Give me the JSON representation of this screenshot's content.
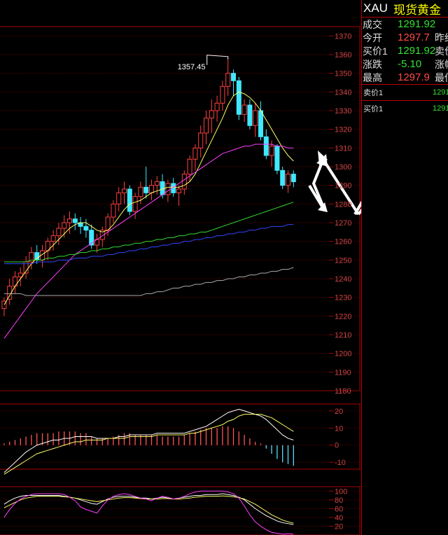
{
  "sidebar": {
    "symbol": "XAU",
    "name": "现货黄金",
    "quotes": [
      {
        "label": "成交",
        "value": "1291.92",
        "color": "dn",
        "tail": ""
      },
      {
        "label": "今开",
        "value": "1297.7",
        "color": "up",
        "tail": "昨结"
      },
      {
        "label": "买价1",
        "value": "1291.92",
        "color": "dn",
        "tail": "卖价"
      },
      {
        "label": "涨跌",
        "value": "-5.10",
        "color": "dn",
        "tail": "涨幅"
      },
      {
        "label": "最高",
        "value": "1297.9",
        "color": "up",
        "tail": "最低"
      }
    ],
    "sell": {
      "label": "卖价1",
      "value": "1291"
    },
    "buy": {
      "label": "买价1",
      "value": "1291"
    }
  },
  "chart_data": [
    {
      "type": "candlestick",
      "panel": "price",
      "annotation": "1357.45",
      "ylim": [
        1180,
        1375
      ],
      "yticks": [
        1180,
        1190,
        1200,
        1210,
        1220,
        1230,
        1240,
        1250,
        1260,
        1270,
        1280,
        1290,
        1300,
        1310,
        1320,
        1330,
        1340,
        1350,
        1360,
        1370
      ],
      "ohlc": [
        [
          1224,
          1230,
          1220,
          1228
        ],
        [
          1229,
          1240,
          1226,
          1236
        ],
        [
          1236,
          1244,
          1232,
          1241
        ],
        [
          1241,
          1246,
          1236,
          1243
        ],
        [
          1243,
          1252,
          1240,
          1249
        ],
        [
          1249,
          1257,
          1245,
          1254
        ],
        [
          1254,
          1258,
          1248,
          1250
        ],
        [
          1250,
          1258,
          1246,
          1255
        ],
        [
          1255,
          1262,
          1250,
          1260
        ],
        [
          1260,
          1266,
          1255,
          1263
        ],
        [
          1263,
          1270,
          1258,
          1267
        ],
        [
          1267,
          1274,
          1262,
          1270
        ],
        [
          1270,
          1276,
          1264,
          1272
        ],
        [
          1272,
          1275,
          1266,
          1270
        ],
        [
          1270,
          1273,
          1264,
          1268
        ],
        [
          1268,
          1272,
          1262,
          1266
        ],
        [
          1266,
          1269,
          1256,
          1258
        ],
        [
          1258,
          1264,
          1254,
          1261
        ],
        [
          1261,
          1268,
          1257,
          1266
        ],
        [
          1266,
          1275,
          1263,
          1273
        ],
        [
          1273,
          1282,
          1270,
          1280
        ],
        [
          1280,
          1289,
          1276,
          1286
        ],
        [
          1286,
          1292,
          1280,
          1288
        ],
        [
          1288,
          1290,
          1274,
          1276
        ],
        [
          1276,
          1286,
          1272,
          1284
        ],
        [
          1284,
          1292,
          1280,
          1289
        ],
        [
          1289,
          1300,
          1283,
          1286
        ],
        [
          1286,
          1293,
          1282,
          1290
        ],
        [
          1290,
          1295,
          1285,
          1292
        ],
        [
          1292,
          1296,
          1283,
          1285
        ],
        [
          1285,
          1293,
          1281,
          1291
        ],
        [
          1291,
          1294,
          1284,
          1286
        ],
        [
          1286,
          1290,
          1279,
          1288
        ],
        [
          1288,
          1298,
          1285,
          1296
        ],
        [
          1296,
          1306,
          1292,
          1304
        ],
        [
          1304,
          1312,
          1298,
          1310
        ],
        [
          1310,
          1322,
          1305,
          1318
        ],
        [
          1318,
          1330,
          1312,
          1326
        ],
        [
          1326,
          1336,
          1318,
          1330
        ],
        [
          1330,
          1338,
          1324,
          1334
        ],
        [
          1334,
          1346,
          1330,
          1343
        ],
        [
          1343,
          1357.45,
          1338,
          1350
        ],
        [
          1350,
          1352,
          1338,
          1346
        ],
        [
          1346,
          1348,
          1325,
          1328
        ],
        [
          1328,
          1336,
          1324,
          1333
        ],
        [
          1333,
          1336,
          1320,
          1322
        ],
        [
          1322,
          1334,
          1316,
          1330
        ],
        [
          1330,
          1335,
          1314,
          1316
        ],
        [
          1316,
          1320,
          1304,
          1306
        ],
        [
          1306,
          1314,
          1300,
          1311
        ],
        [
          1311,
          1312,
          1296,
          1298
        ],
        [
          1298,
          1300,
          1288,
          1290
        ],
        [
          1290,
          1298,
          1286,
          1296
        ],
        [
          1296,
          1298,
          1289,
          1291.92
        ]
      ],
      "series": [
        {
          "color": "#ffff66",
          "values": [
            1226,
            1231,
            1236,
            1240,
            1244,
            1248,
            1251,
            1253,
            1255,
            1258,
            1261,
            1264,
            1267,
            1269,
            1270,
            1270,
            1268,
            1266,
            1265,
            1266,
            1269,
            1273,
            1277,
            1280,
            1281,
            1282,
            1284,
            1286,
            1287,
            1288,
            1289,
            1289,
            1289,
            1290,
            1292,
            1296,
            1302,
            1308,
            1314,
            1320,
            1326,
            1333,
            1338,
            1340,
            1339,
            1337,
            1334,
            1330,
            1325,
            1320,
            1315,
            1310,
            1306,
            1303
          ]
        },
        {
          "color": "#ff40ff",
          "values": [
            1208,
            1212,
            1216,
            1220,
            1224,
            1228,
            1232,
            1235,
            1238,
            1241,
            1244,
            1247,
            1250,
            1253,
            1255,
            1257,
            1259,
            1261,
            1263,
            1265,
            1267,
            1269,
            1271,
            1273,
            1275,
            1277,
            1279,
            1281,
            1283,
            1285,
            1287,
            1289,
            1291,
            1293,
            1295,
            1297,
            1299,
            1301,
            1303,
            1305,
            1307,
            1308,
            1309,
            1310,
            1311,
            1311,
            1312,
            1312,
            1312,
            1312,
            1311,
            1311,
            1310,
            1310
          ]
        },
        {
          "color": "#33dd33",
          "values": [
            1249,
            1249,
            1249,
            1249,
            1249,
            1250,
            1250,
            1250,
            1251,
            1251,
            1252,
            1252,
            1253,
            1253,
            1254,
            1254,
            1255,
            1255,
            1256,
            1256,
            1257,
            1257,
            1258,
            1258,
            1259,
            1259,
            1260,
            1260,
            1261,
            1261,
            1262,
            1262,
            1263,
            1263,
            1264,
            1264,
            1265,
            1265,
            1266,
            1267,
            1268,
            1269,
            1270,
            1271,
            1272,
            1273,
            1274,
            1275,
            1276,
            1277,
            1278,
            1279,
            1280,
            1281
          ]
        },
        {
          "color": "#3344ff",
          "values": [
            1248,
            1248,
            1248,
            1248,
            1248,
            1248,
            1249,
            1249,
            1249,
            1249,
            1250,
            1250,
            1250,
            1251,
            1251,
            1251,
            1252,
            1252,
            1252,
            1253,
            1253,
            1254,
            1254,
            1255,
            1255,
            1256,
            1256,
            1257,
            1257,
            1258,
            1258,
            1259,
            1259,
            1260,
            1260,
            1261,
            1261,
            1262,
            1262,
            1263,
            1263,
            1264,
            1264,
            1265,
            1265,
            1266,
            1266,
            1267,
            1267,
            1268,
            1268,
            1268,
            1269,
            1269
          ]
        },
        {
          "color": "#aaaaaa",
          "values": [
            1232,
            1232,
            1232,
            1232,
            1231,
            1231,
            1231,
            1231,
            1231,
            1231,
            1231,
            1231,
            1231,
            1231,
            1231,
            1231,
            1231,
            1231,
            1231,
            1231,
            1231,
            1231,
            1231,
            1231,
            1231,
            1231,
            1232,
            1232,
            1233,
            1233,
            1234,
            1235,
            1235,
            1236,
            1236,
            1237,
            1237,
            1238,
            1238,
            1239,
            1239,
            1240,
            1240,
            1241,
            1241,
            1242,
            1242,
            1243,
            1243,
            1244,
            1244,
            1245,
            1245,
            1246
          ]
        }
      ]
    },
    {
      "type": "bar",
      "panel": "macd",
      "ylim": [
        -14,
        24
      ],
      "yticks": [
        -10,
        0,
        10,
        20
      ],
      "values": [
        1,
        2,
        3,
        4,
        5,
        6,
        7,
        7,
        7,
        7,
        8,
        8,
        8,
        8,
        7,
        7,
        5,
        4,
        4,
        4,
        5,
        6,
        7,
        7,
        6,
        6,
        6,
        6,
        6,
        5,
        5,
        5,
        5,
        6,
        7,
        8,
        9,
        10,
        10,
        10,
        11,
        11,
        10,
        8,
        6,
        4,
        2,
        1,
        -2,
        -5,
        -8,
        -10,
        -11,
        -12
      ],
      "series": [
        {
          "color": "#ffffff",
          "values": [
            -16,
            -13,
            -10,
            -7,
            -4,
            -2,
            0,
            1,
            2,
            3,
            3,
            4,
            4,
            5,
            5,
            5,
            5,
            4,
            4,
            4,
            4,
            5,
            5,
            6,
            6,
            6,
            6,
            6,
            7,
            7,
            7,
            7,
            7,
            7,
            8,
            9,
            10,
            11,
            13,
            15,
            17,
            19,
            20,
            21,
            20,
            19,
            18,
            17,
            15,
            12,
            9,
            6,
            4,
            3
          ]
        },
        {
          "color": "#ffff66",
          "values": [
            -17,
            -15,
            -13,
            -11,
            -9,
            -7,
            -5,
            -4,
            -3,
            -2,
            -1,
            0,
            1,
            2,
            2,
            3,
            3,
            3,
            3,
            4,
            4,
            4,
            4,
            5,
            5,
            5,
            5,
            5,
            6,
            6,
            6,
            6,
            6,
            6,
            7,
            7,
            8,
            9,
            10,
            11,
            12,
            14,
            15,
            17,
            18,
            18,
            18,
            18,
            17,
            16,
            14,
            12,
            10,
            8
          ]
        }
      ]
    },
    {
      "type": "line",
      "panel": "kdj",
      "ylim": [
        0,
        110
      ],
      "yticks": [
        20,
        40,
        60,
        80,
        100
      ],
      "series": [
        {
          "color": "#ffffff",
          "values": [
            70,
            78,
            84,
            88,
            90,
            90,
            90,
            90,
            90,
            90,
            90,
            88,
            86,
            84,
            80,
            76,
            72,
            70,
            76,
            82,
            86,
            88,
            88,
            88,
            86,
            84,
            84,
            82,
            84,
            86,
            84,
            82,
            84,
            86,
            88,
            90,
            90,
            92,
            92,
            92,
            94,
            92,
            90,
            86,
            80,
            70,
            60,
            52,
            44,
            38,
            32,
            28,
            26,
            24
          ]
        },
        {
          "color": "#ffff66",
          "values": [
            62,
            68,
            74,
            80,
            84,
            86,
            88,
            88,
            88,
            88,
            88,
            87,
            86,
            84,
            82,
            80,
            78,
            76,
            78,
            80,
            82,
            84,
            85,
            85,
            84,
            83,
            82,
            82,
            82,
            83,
            83,
            82,
            82,
            83,
            84,
            86,
            87,
            88,
            88,
            88,
            89,
            88,
            87,
            85,
            82,
            76,
            70,
            62,
            54,
            46,
            40,
            34,
            30,
            27
          ]
        },
        {
          "color": "#ff40ff",
          "values": [
            40,
            58,
            72,
            82,
            88,
            92,
            94,
            94,
            94,
            94,
            94,
            92,
            86,
            78,
            64,
            58,
            54,
            50,
            66,
            80,
            88,
            92,
            94,
            92,
            88,
            84,
            82,
            78,
            84,
            88,
            86,
            82,
            84,
            88,
            94,
            98,
            100,
            100,
            100,
            100,
            100,
            98,
            94,
            84,
            66,
            46,
            30,
            20,
            12,
            6,
            4,
            2,
            3,
            2
          ]
        }
      ]
    }
  ]
}
